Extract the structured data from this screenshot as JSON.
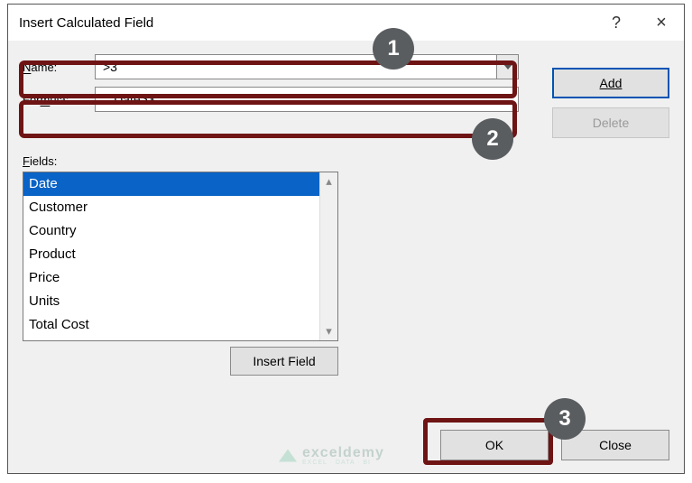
{
  "titlebar": {
    "title": "Insert Calculated Field",
    "help": "?",
    "close": "×"
  },
  "form": {
    "name_label": "Name:",
    "name_value": ">3",
    "formula_label": "Formula:",
    "formula_value": "= Date>3"
  },
  "side": {
    "add": "Add",
    "delete": "Delete"
  },
  "fields": {
    "label": "Fields:",
    "items": [
      "Date",
      "Customer",
      "Country",
      "Product",
      "Price",
      "Units",
      "Total Cost"
    ],
    "selected_index": 0,
    "insert_button": "Insert Field"
  },
  "bottom": {
    "ok": "OK",
    "close": "Close"
  },
  "annotations": {
    "badge1": "1",
    "badge2": "2",
    "badge3": "3"
  },
  "watermark": {
    "text": "exceldemy",
    "sub": "EXCEL · DATA · BI"
  }
}
